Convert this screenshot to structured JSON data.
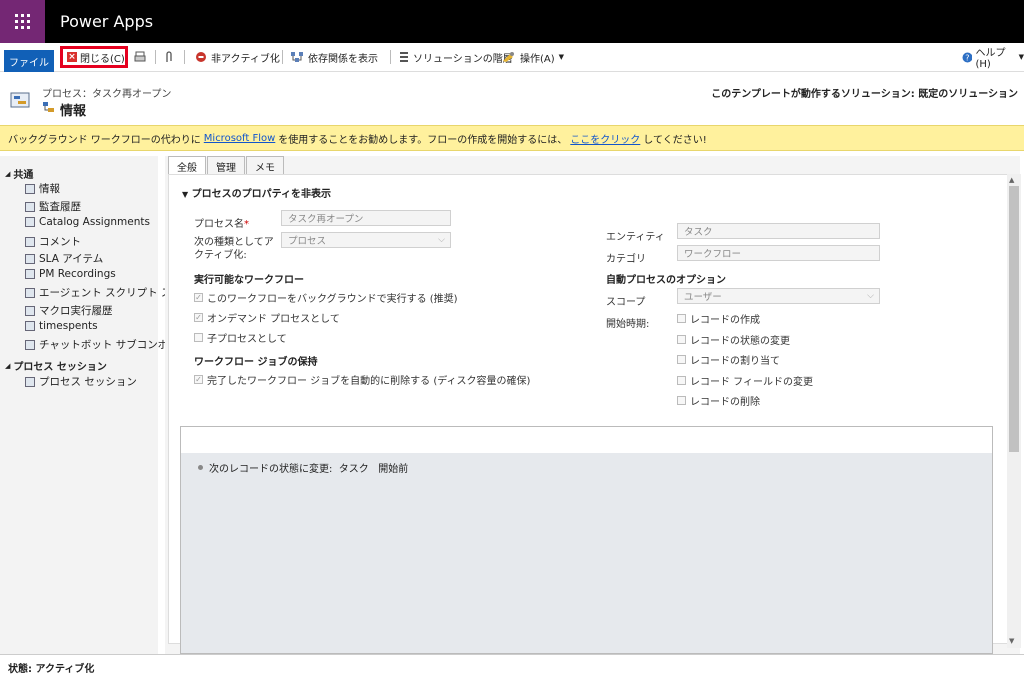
{
  "app": {
    "title": "Power Apps"
  },
  "toolbar": {
    "file_label": "ファイル",
    "close_label": "閉じる(C)",
    "deactivate_label": "非アクティブ化",
    "dependencies_label": "依存関係を表示",
    "solution_layers_label": "ソリューションの階層",
    "actions_label": "操作(A)",
    "help_label": "ヘルプ(H)"
  },
  "header": {
    "breadcrumb": "プロセス：タスク再オープン",
    "title": "情報",
    "solution": "このテンプレートが動作するソリューション: 既定のソリューション"
  },
  "banner": {
    "text1": "バックグラウンド ワークフローの代わりに",
    "link1": "Microsoft Flow",
    "text2": "を使用することをお勧めします。フローの作成を開始するには、",
    "link2": "ここをクリック",
    "text3": "してください!"
  },
  "nav": {
    "group1": "共通",
    "items": [
      "情報",
      "監査履歴",
      "Catalog Assignments",
      "コメント",
      "SLA アイテム",
      "PM Recordings",
      "エージェント スクリプト ス...",
      "マクロ実行履歴",
      "timespents",
      "チャットボット サブコンポ..."
    ],
    "group2": "プロセス セッション",
    "items2": [
      "プロセス セッション"
    ]
  },
  "tabs": [
    "全般",
    "管理",
    "メモ"
  ],
  "form": {
    "section_title": "プロセスのプロパティを非表示",
    "process_name_label": "プロセス名",
    "process_name_value": "タスク再オープン",
    "activate_as_label": "次の種類としてアクティブ化:",
    "activate_as_value": "プロセス",
    "entity_label": "エンティティ",
    "entity_value": "タスク",
    "category_label": "カテゴリ",
    "category_value": "ワークフロー",
    "available_heading": "実行可能なワークフロー",
    "run_background": "このワークフローをバックグラウンドで実行する (推奨)",
    "on_demand": "オンデマンド プロセスとして",
    "child_process": "子プロセスとして",
    "retention_heading": "ワークフロー ジョブの保持",
    "auto_delete": "完了したワークフロー ジョブを自動的に削除する (ディスク容量の確保)",
    "auto_heading": "自動プロセスのオプション",
    "scope_label": "スコープ",
    "scope_value": "ユーザー",
    "start_label": "開始時期:",
    "start_options": [
      "レコードの作成",
      "レコードの状態の変更",
      "レコードの割り当て",
      "レコード フィールドの変更",
      "レコードの削除"
    ]
  },
  "designer": {
    "step": "次のレコードの状態に変更:  タスク   開始前"
  },
  "status": {
    "text": "状態: アクティブ化"
  }
}
